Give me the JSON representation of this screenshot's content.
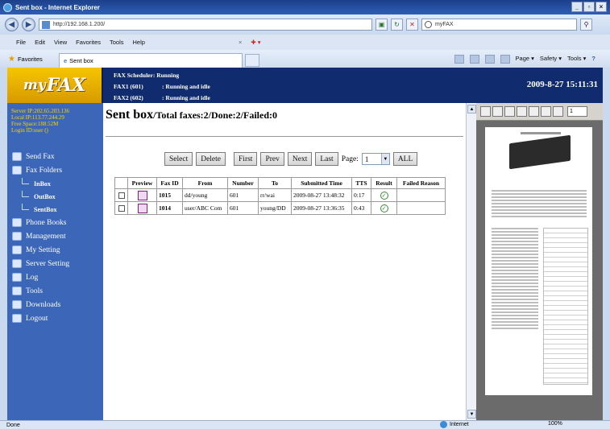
{
  "window": {
    "title": "Sent box - Internet Explorer",
    "address": "http://192.168.1.200/",
    "search_text": "myFAX"
  },
  "menu": [
    "File",
    "Edit",
    "View",
    "Favorites",
    "Tools",
    "Help"
  ],
  "favbar": {
    "favorites_label": "Favorites",
    "tab_label": "Sent box",
    "commands": [
      "Page ▾",
      "Safety ▾",
      "Tools ▾"
    ]
  },
  "header": {
    "logo_my": "my",
    "logo_fax": "FAX",
    "status_title": "FAX Scheduler: Running",
    "lines": [
      {
        "name": "FAX1 (601)",
        "state": ": Running and idle"
      },
      {
        "name": "FAX2 (602)",
        "state": ": Running and idle"
      }
    ],
    "datetime": "2009-8-27 15:11:31"
  },
  "sidebar": {
    "server_ip": "Server IP:202.65.203.136",
    "local_ip": "Local IP:113.77.244.29",
    "free_space": "Free Space:188.52M",
    "login": "Login ID:user ()",
    "items": [
      {
        "label": "Send Fax",
        "type": "item"
      },
      {
        "label": "Fax Folders",
        "type": "item"
      },
      {
        "label": "InBox",
        "type": "sub"
      },
      {
        "label": "OutBox",
        "type": "sub"
      },
      {
        "label": "SentBox",
        "type": "sub"
      },
      {
        "label": "Phone Books",
        "type": "item"
      },
      {
        "label": "Management",
        "type": "item"
      },
      {
        "label": "My Setting",
        "type": "item"
      },
      {
        "label": "Server Setting",
        "type": "item"
      },
      {
        "label": "Log",
        "type": "item"
      },
      {
        "label": "Tools",
        "type": "item"
      },
      {
        "label": "Downloads",
        "type": "item"
      },
      {
        "label": "Logout",
        "type": "item"
      }
    ]
  },
  "main": {
    "title": "Sent box",
    "summary": "/Total faxes:2/Done:2/Failed:0",
    "buttons": {
      "select": "Select",
      "delete": "Delete",
      "first": "First",
      "prev": "Prev",
      "next": "Next",
      "last": "Last",
      "all": "ALL"
    },
    "page_label": "Page:",
    "page_value": "1",
    "columns": [
      "",
      "Preview",
      "Fax ID",
      "From",
      "Number",
      "To",
      "Submitted Time",
      "TTS",
      "Result",
      "Failed Reason"
    ],
    "rows": [
      {
        "fax_id": "1015",
        "from": "dd/young",
        "number": "601",
        "to": "rr/wai",
        "submitted": "2009-08-27 13:48:32",
        "tts": "0:17",
        "reason": ""
      },
      {
        "fax_id": "1014",
        "from": "user/ABC Com",
        "number": "601",
        "to": "young/DD",
        "submitted": "2009-08-27 13:36:35",
        "tts": "0:43",
        "reason": ""
      }
    ]
  },
  "preview_pane": {
    "page_number": "1"
  },
  "statusbar": {
    "left": "Done",
    "zone": "Internet",
    "zoom": "100%"
  }
}
